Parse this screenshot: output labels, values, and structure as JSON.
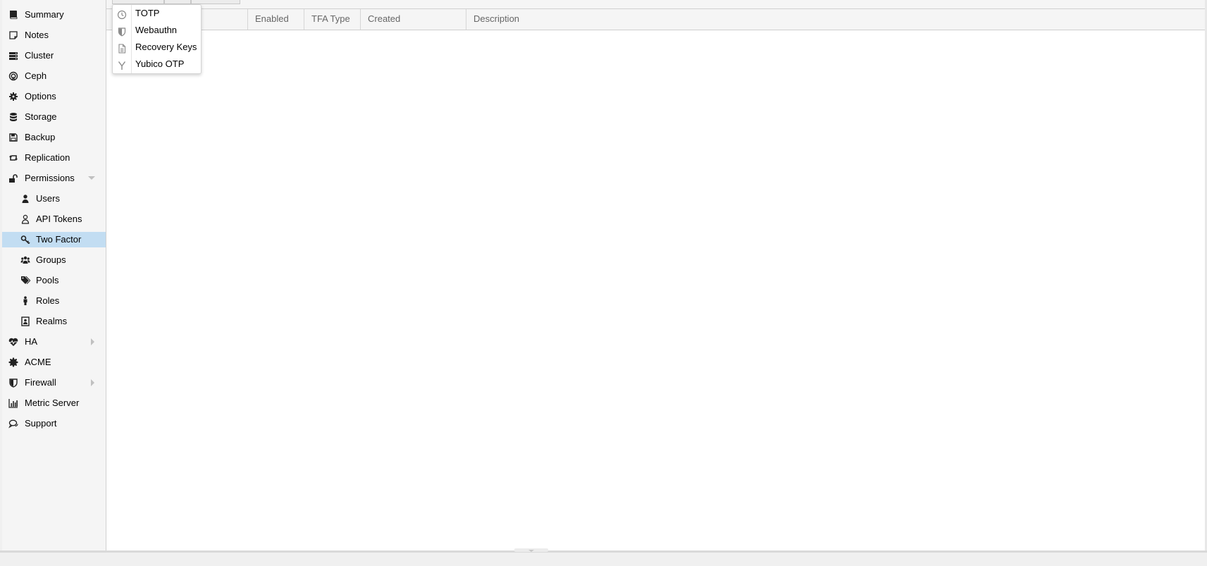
{
  "sidebar": {
    "items": [
      {
        "label": "Summary",
        "icon": "book-icon",
        "level": 1
      },
      {
        "label": "Notes",
        "icon": "note-icon",
        "level": 1
      },
      {
        "label": "Cluster",
        "icon": "server-icon",
        "level": 1
      },
      {
        "label": "Ceph",
        "icon": "ceph-icon",
        "level": 1
      },
      {
        "label": "Options",
        "icon": "gear-icon",
        "level": 1
      },
      {
        "label": "Storage",
        "icon": "database-icon",
        "level": 1
      },
      {
        "label": "Backup",
        "icon": "floppy-icon",
        "level": 1
      },
      {
        "label": "Replication",
        "icon": "retweet-icon",
        "level": 1
      },
      {
        "label": "Permissions",
        "icon": "unlock-icon",
        "level": 1,
        "expander": "expanded"
      },
      {
        "label": "Users",
        "icon": "user-icon",
        "level": 2
      },
      {
        "label": "API Tokens",
        "icon": "user-outline-icon",
        "level": 2
      },
      {
        "label": "Two Factor",
        "icon": "key-icon",
        "level": 2,
        "selected": true
      },
      {
        "label": "Groups",
        "icon": "users-icon",
        "level": 2
      },
      {
        "label": "Pools",
        "icon": "tags-icon",
        "level": 2
      },
      {
        "label": "Roles",
        "icon": "male-icon",
        "level": 2
      },
      {
        "label": "Realms",
        "icon": "address-book-icon",
        "level": 2
      },
      {
        "label": "HA",
        "icon": "heartbeat-icon",
        "level": 1,
        "expander": "collapsed"
      },
      {
        "label": "ACME",
        "icon": "certificate-icon",
        "level": 1
      },
      {
        "label": "Firewall",
        "icon": "shield-icon",
        "level": 1,
        "expander": "collapsed"
      },
      {
        "label": "Metric Server",
        "icon": "bar-chart-icon",
        "level": 1
      },
      {
        "label": "Support",
        "icon": "comments-icon",
        "level": 1
      }
    ]
  },
  "grid": {
    "columns": [
      "Enabled",
      "TFA Type",
      "Created",
      "Description"
    ]
  },
  "add_menu": {
    "items": [
      {
        "label": "TOTP",
        "icon": "clock-icon"
      },
      {
        "label": "Webauthn",
        "icon": "shield-icon"
      },
      {
        "label": "Recovery Keys",
        "icon": "file-text-icon"
      },
      {
        "label": "Yubico OTP",
        "icon": "yubico-icon"
      }
    ]
  },
  "colors": {
    "selected_bg": "#c2ddf2",
    "sidebar_bg": "#f5f5f5",
    "header_text": "#666666"
  }
}
